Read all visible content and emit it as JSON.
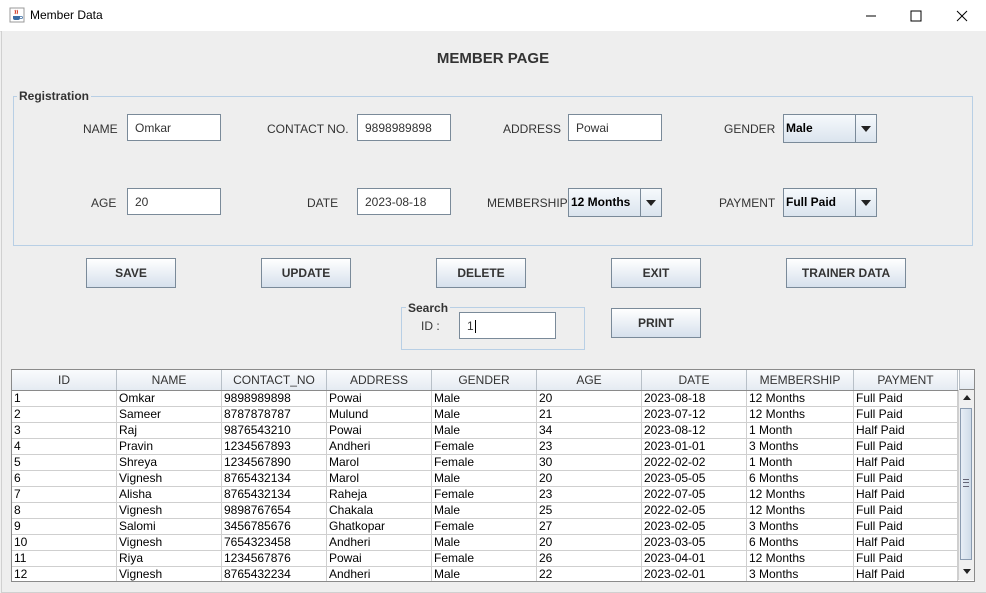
{
  "window": {
    "title": "Member Data",
    "icon": "java-cup-icon"
  },
  "page_title": "MEMBER PAGE",
  "registration": {
    "legend": "Registration",
    "name_label": "NAME",
    "name_value": "Omkar",
    "contact_label": "CONTACT NO.",
    "contact_value": "9898989898",
    "address_label": "ADDRESS",
    "address_value": "Powai",
    "gender_label": "GENDER",
    "gender_value": "Male",
    "age_label": "AGE",
    "age_value": "20",
    "date_label": "DATE",
    "date_value": "2023-08-18",
    "membership_label": "MEMBERSHIP",
    "membership_value": "12 Months",
    "payment_label": "PAYMENT",
    "payment_value": "Full Paid"
  },
  "buttons": {
    "save": "SAVE",
    "update": "UPDATE",
    "delete": "DELETE",
    "exit": "EXIT",
    "trainer": "TRAINER DATA",
    "print": "PRINT"
  },
  "search": {
    "legend": "Search",
    "id_label": "ID :",
    "id_value": "1"
  },
  "table": {
    "columns": [
      "ID",
      "NAME",
      "CONTACT_NO",
      "ADDRESS",
      "GENDER",
      "AGE",
      "DATE",
      "MEMBERSHIP",
      "PAYMENT"
    ],
    "rows": [
      [
        "1",
        "Omkar",
        "9898989898",
        "Powai",
        "Male",
        "20",
        "2023-08-18",
        "12 Months",
        "Full Paid"
      ],
      [
        "2",
        "Sameer",
        "8787878787",
        "Mulund",
        "Male",
        "21",
        "2023-07-12",
        "12 Months",
        "Full Paid"
      ],
      [
        "3",
        "Raj",
        "9876543210",
        "Powai",
        "Male",
        "34",
        "2023-08-12",
        "1 Month",
        "Half Paid"
      ],
      [
        "4",
        "Pravin",
        "1234567893",
        "Andheri",
        "Female",
        "23",
        "2023-01-01",
        "3 Months",
        "Full Paid"
      ],
      [
        "5",
        "Shreya",
        "1234567890",
        "Marol",
        "Female",
        "30",
        "2022-02-02",
        "1 Month",
        "Half Paid"
      ],
      [
        "6",
        "Vignesh",
        "8765432134",
        "Marol",
        "Male",
        "20",
        "2023-05-05",
        "6 Months",
        "Full Paid"
      ],
      [
        "7",
        "Alisha",
        "8765432134",
        "Raheja",
        "Female",
        "23",
        "2022-07-05",
        "12 Months",
        "Half Paid"
      ],
      [
        "8",
        "Vignesh",
        "9898767654",
        "Chakala",
        "Male",
        "25",
        "2022-02-05",
        "12 Months",
        "Full Paid"
      ],
      [
        "9",
        "Salomi",
        "3456785676",
        "Ghatkopar",
        "Female",
        "27",
        "2023-02-05",
        "3 Months",
        "Full Paid"
      ],
      [
        "10",
        "Vignesh",
        "7654323458",
        "Andheri",
        "Male",
        "20",
        "2023-03-05",
        "6 Months",
        "Half Paid"
      ],
      [
        "11",
        "Riya",
        "1234567876",
        "Powai",
        "Female",
        "26",
        "2023-04-01",
        "12 Months",
        "Full Paid"
      ],
      [
        "12",
        "Vignesh",
        "8765432234",
        "Andheri",
        "Male",
        "22",
        "2023-02-01",
        "3 Months",
        "Half Paid"
      ]
    ]
  }
}
